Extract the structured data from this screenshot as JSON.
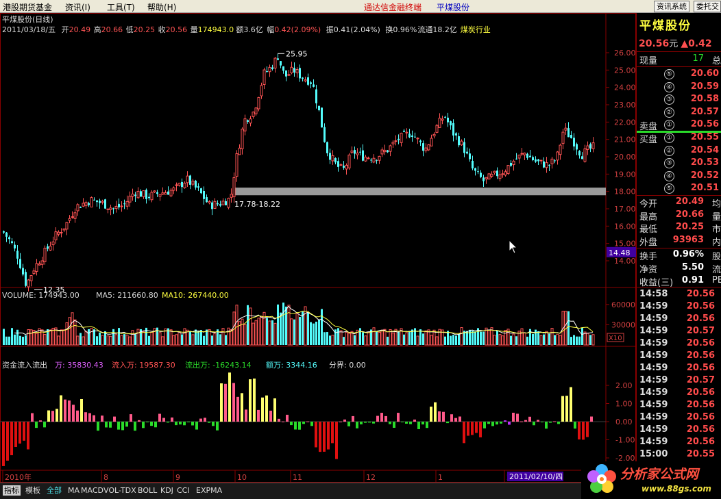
{
  "menubar": {
    "left": [
      "港股期货基金",
      "资讯(I)",
      "工具(T)",
      "帮助(H)"
    ],
    "center_app": "通达信金融终端",
    "center_stock": "平煤股份",
    "right_buttons": [
      "资讯系统",
      "委托交"
    ]
  },
  "chart": {
    "title": "平煤股份(日线)",
    "info": {
      "date": "2011/03/18/五",
      "open_label": "开",
      "open": "20.49",
      "high_label": "高",
      "high": "20.66",
      "low_label": "低",
      "low": "20.25",
      "close_label": "收",
      "close": "20.56",
      "vol_label": "量",
      "vol": "174943.0",
      "amt_label": "额",
      "amt": "3.6亿",
      "range_label": "幅",
      "range": "0.42(2.09%)",
      "amp_label": "振",
      "amp": "0.41(2.04%)",
      "turn_label": "换",
      "turn": "0.96%",
      "float_label": "流通",
      "float": "18.2亿",
      "industry": "煤炭行业"
    },
    "price_axis": [
      "26.00",
      "25.00",
      "24.00",
      "23.00",
      "22.00",
      "21.00",
      "20.00",
      "19.00",
      "18.00",
      "17.00",
      "16.00",
      "15.00",
      "14.00"
    ],
    "current_tag": "14.48",
    "annotations": {
      "high": "25.95",
      "low": "12.35",
      "band": "17.78-18.22"
    },
    "volume_header": {
      "volume": "VOLUME: 174943.00",
      "ma5": "MA5: 211660.80",
      "ma10": "MA10: 267440.00"
    },
    "volume_axis": [
      "60000",
      "30000"
    ],
    "volume_unit": "X10",
    "flow_header": {
      "title": "资金流入流出",
      "wan": "万: 35830.43",
      "in": "流入万: 19587.30",
      "out": "流出万: -16243.14",
      "amt": "额万: 3344.16",
      "boundary": "分界: 0.00"
    },
    "flow_axis": [
      "2.00",
      "1.00",
      "0.00",
      "-1.00",
      "-2.00"
    ],
    "months": [
      "2010年",
      "8",
      "9",
      "10",
      "11",
      "12",
      "1",
      "2"
    ],
    "date_tag": "2011/02/10/四",
    "colors": {
      "up": "#ff5454",
      "down": "#54fcfc",
      "bg": "#000000",
      "grid": "#8a0000",
      "ma5": "#ffffff",
      "ma10": "#ffff40"
    }
  },
  "panel": {
    "name": "平煤股份",
    "price": "20.56",
    "unit": "元",
    "change": "▲0.42",
    "xianliang_label": "现量",
    "xianliang": "17",
    "zong": "总",
    "sell_label": "卖盘",
    "buy_label": "买盘",
    "sells": [
      {
        "n": "⑤",
        "p": "20.60"
      },
      {
        "n": "④",
        "p": "20.59"
      },
      {
        "n": "③",
        "p": "20.58"
      },
      {
        "n": "②",
        "p": "20.57"
      },
      {
        "n": "①",
        "p": "20.56"
      }
    ],
    "buys": [
      {
        "n": "①",
        "p": "20.55"
      },
      {
        "n": "②",
        "p": "20.54"
      },
      {
        "n": "③",
        "p": "20.53"
      },
      {
        "n": "④",
        "p": "20.52"
      },
      {
        "n": "⑤",
        "p": "20.51"
      }
    ],
    "stats": [
      {
        "l": "今开",
        "v": "20.49",
        "r": "均",
        "c": "red"
      },
      {
        "l": "最高",
        "v": "20.66",
        "r": "量",
        "c": "red"
      },
      {
        "l": "最低",
        "v": "20.25",
        "r": "市",
        "c": "red"
      },
      {
        "l": "外盘",
        "v": "93963",
        "r": "内",
        "c": "red"
      },
      {
        "l": "换手",
        "v": "0.96%",
        "r": "股",
        "c": "white"
      },
      {
        "l": "净资",
        "v": "5.50",
        "r": "流",
        "c": "white"
      },
      {
        "l": "收益(三)",
        "v": "0.91",
        "r": "PE",
        "c": "white"
      }
    ],
    "ticks": [
      {
        "t": "14:58",
        "p": "20.56"
      },
      {
        "t": "14:59",
        "p": "20.56"
      },
      {
        "t": "14:59",
        "p": "20.56"
      },
      {
        "t": "14:59",
        "p": "20.57"
      },
      {
        "t": "14:59",
        "p": "20.56"
      },
      {
        "t": "14:59",
        "p": "20.56"
      },
      {
        "t": "14:59",
        "p": "20.56"
      },
      {
        "t": "14:59",
        "p": "20.57"
      },
      {
        "t": "14:59",
        "p": "20.56"
      },
      {
        "t": "14:59",
        "p": "20.56"
      },
      {
        "t": "14:59",
        "p": "20.56"
      },
      {
        "t": "14:59",
        "p": "20.56"
      },
      {
        "t": "14:59",
        "p": "20.56"
      },
      {
        "t": "15:00",
        "p": "20.55"
      }
    ]
  },
  "bottom_tabs": [
    "指标",
    "模板",
    "全部",
    "MA",
    "MACD",
    "VOL-TDX",
    "BOLL",
    "KDJ",
    "CCI",
    "EXPMA"
  ],
  "logo": {
    "text": "分析家公式网",
    "url": "www.88gs.com"
  }
}
